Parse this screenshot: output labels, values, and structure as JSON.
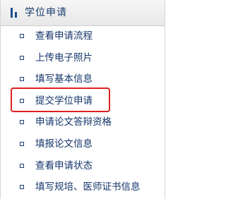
{
  "header": {
    "title": "学位申请",
    "icon": "bar-chart-icon"
  },
  "menu": {
    "items": [
      {
        "label": "查看申请流程"
      },
      {
        "label": "上传电子照片"
      },
      {
        "label": "填写基本信息"
      },
      {
        "label": "提交学位申请"
      },
      {
        "label": "申请论文答辩资格"
      },
      {
        "label": "填报论文信息"
      },
      {
        "label": "查看申请状态"
      },
      {
        "label": "填写规培、医师证书信息"
      }
    ],
    "bullet_icon": "square-bullet-icon"
  },
  "highlight": {
    "target_item": "提交学位申请",
    "color": "#e02020"
  },
  "colors": {
    "text": "#14356b",
    "header_text": "#1a3c6e",
    "header_bg": "#ececec"
  }
}
